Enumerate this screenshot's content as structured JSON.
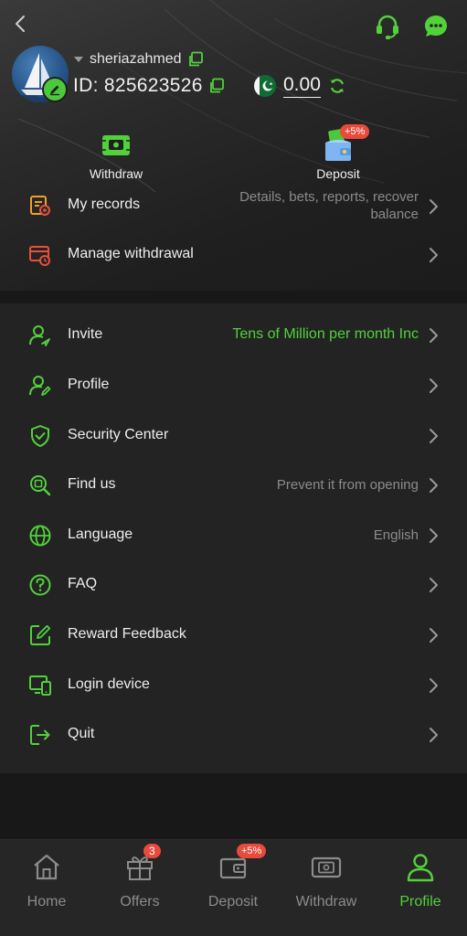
{
  "header": {
    "username": "sheriazahmed",
    "id_label": "ID: 825623526",
    "balance": "0.00"
  },
  "quick_actions": [
    {
      "label": "Withdraw",
      "icon": "withdraw-icon"
    },
    {
      "label": "Deposit",
      "icon": "deposit-icon",
      "badge": "+5%"
    }
  ],
  "records": [
    {
      "label": "My records",
      "value_line1": "Details, bets, reports, recover",
      "value_line2": "balance",
      "icon": "records-icon"
    },
    {
      "label": "Manage withdrawal",
      "value": "",
      "icon": "manage-withdrawal-icon"
    }
  ],
  "menu": [
    {
      "label": "Invite",
      "value": "Tens of Million per month  Inc",
      "icon": "invite-icon"
    },
    {
      "label": "Profile",
      "value": "",
      "icon": "profile-icon"
    },
    {
      "label": "Security Center",
      "value": "",
      "icon": "shield-icon"
    },
    {
      "label": "Find us",
      "value": "Prevent it from opening",
      "icon": "find-us-icon"
    },
    {
      "label": "Language",
      "value": "English",
      "icon": "globe-icon"
    },
    {
      "label": "FAQ",
      "value": "",
      "icon": "question-icon"
    },
    {
      "label": "Reward Feedback",
      "value": "",
      "icon": "edit-icon"
    },
    {
      "label": "Login device",
      "value": "",
      "icon": "devices-icon"
    },
    {
      "label": "Quit",
      "value": "",
      "icon": "logout-icon"
    }
  ],
  "bottom_nav": [
    {
      "label": "Home",
      "icon": "home-icon"
    },
    {
      "label": "Offers",
      "icon": "gift-icon",
      "badge": "3"
    },
    {
      "label": "Deposit",
      "icon": "wallet-icon",
      "badge": "+5%"
    },
    {
      "label": "Withdraw",
      "icon": "withdraw-icon"
    },
    {
      "label": "Profile",
      "icon": "profile-icon",
      "active": true
    }
  ],
  "colors": {
    "accent": "#52d13b",
    "badge": "#e84a3c",
    "background": "#1a1a1a",
    "panel": "#232323",
    "muted_text": "#8b8b8b"
  }
}
